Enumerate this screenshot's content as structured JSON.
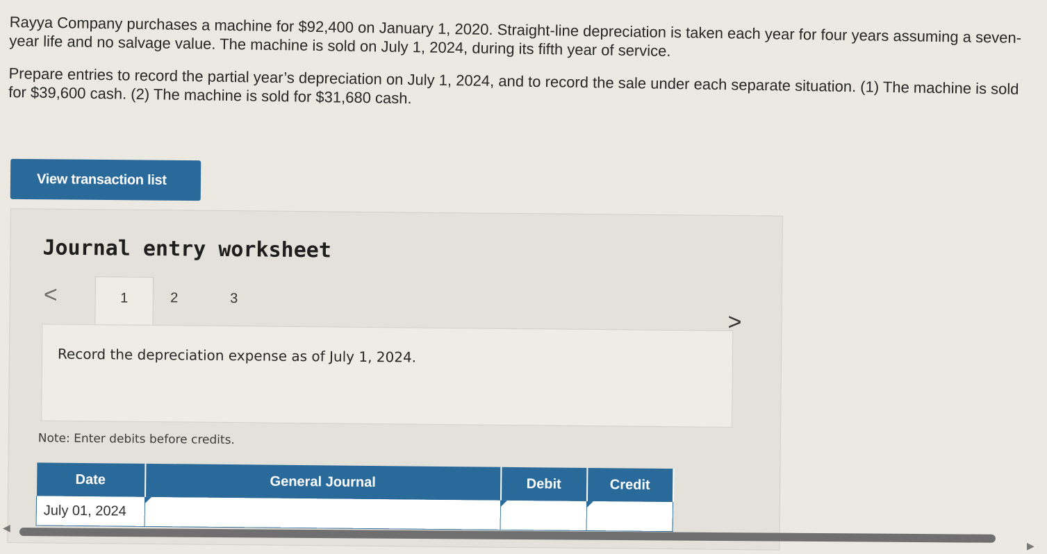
{
  "problem": {
    "paragraph1": "Rayya Company purchases a machine for $92,400 on January 1, 2020. Straight-line depreciation is taken each year for four years assuming a seven-year life and no salvage value. The machine is sold on July 1, 2024, during its fifth year of service.",
    "paragraph2": "Prepare entries to record the partial year’s depreciation on July 1, 2024, and to record the sale under each separate situation. (1) The machine is sold for $39,600 cash. (2) The machine is sold for $31,680 cash."
  },
  "view_transaction_list_label": "View transaction list",
  "worksheet": {
    "title": "Journal entry worksheet",
    "prev_glyph": "<",
    "next_glyph": ">",
    "tabs": [
      {
        "label": "1",
        "active": true
      },
      {
        "label": "2",
        "active": false
      },
      {
        "label": "3",
        "active": false
      }
    ],
    "instruction": "Record the depreciation expense as of July 1, 2024.",
    "note": "Note: Enter debits before credits."
  },
  "journal_table": {
    "headers": {
      "date": "Date",
      "general_journal": "General Journal",
      "debit": "Debit",
      "credit": "Credit"
    },
    "rows": [
      {
        "date": "July 01, 2024",
        "account": "",
        "debit": "",
        "credit": ""
      }
    ]
  },
  "colors": {
    "accent": "#2a6a9a",
    "background": "#ece9e2"
  }
}
